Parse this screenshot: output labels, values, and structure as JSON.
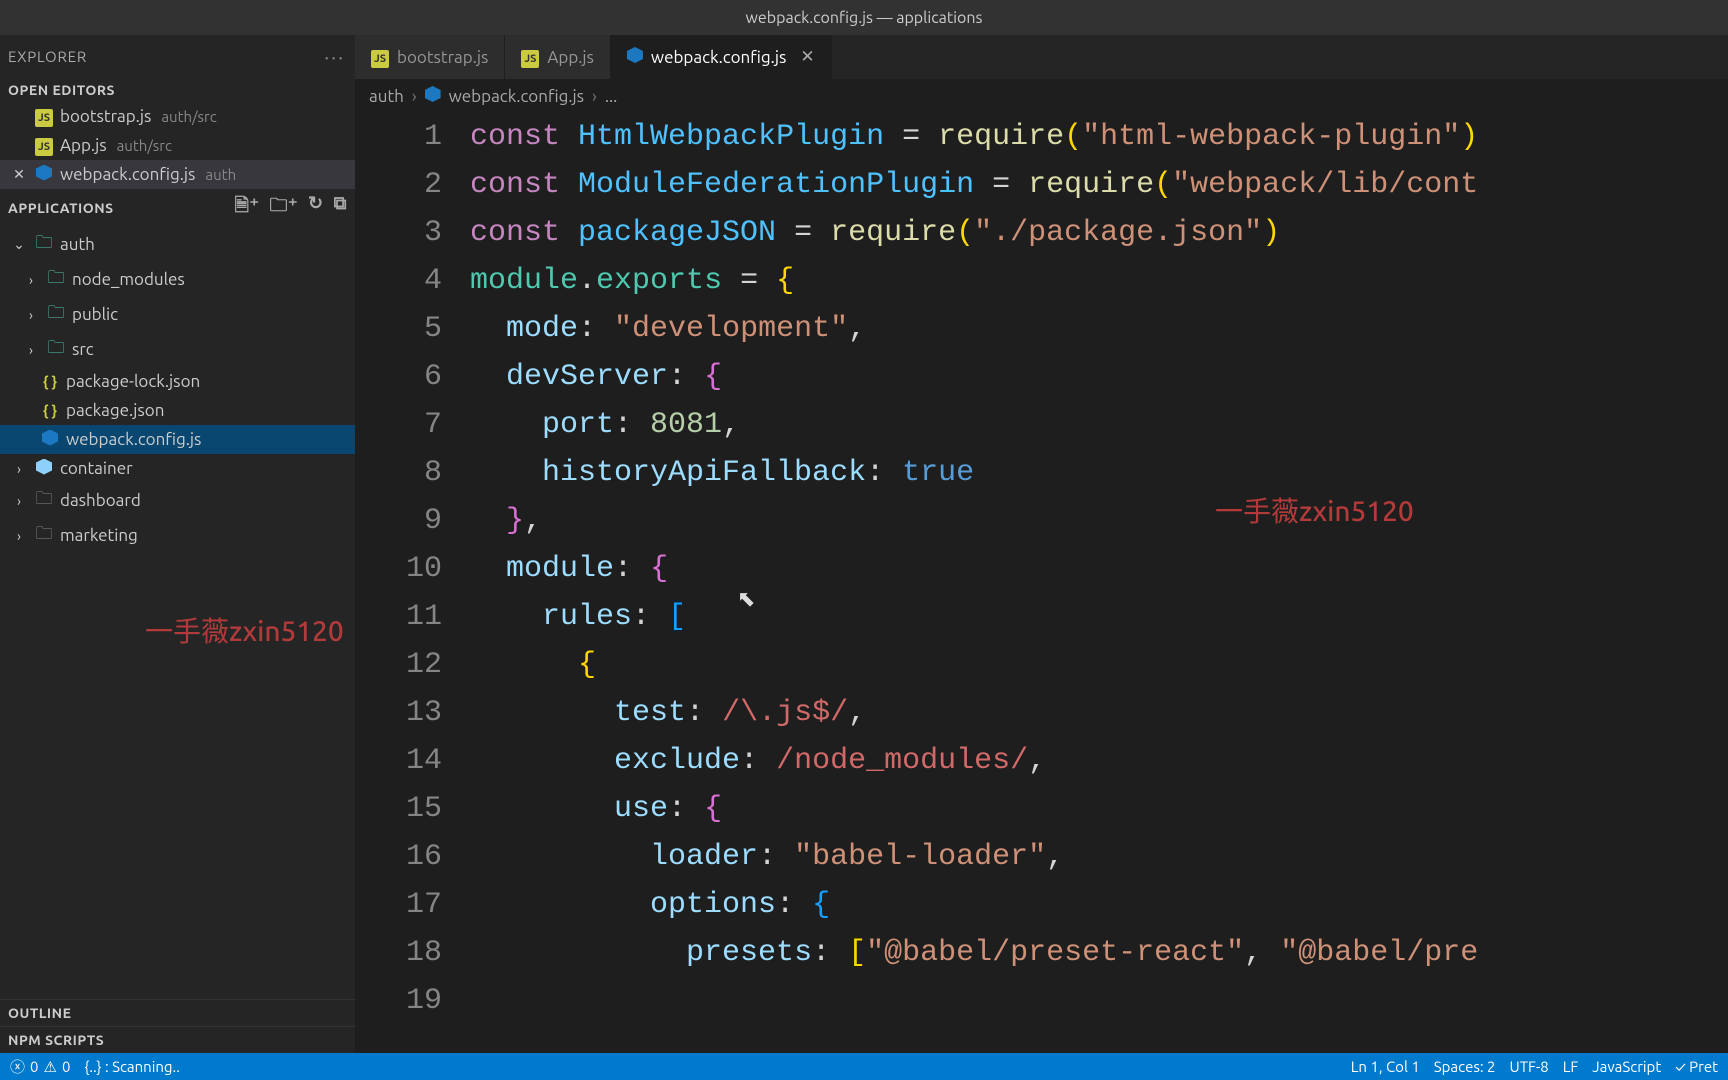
{
  "window": {
    "title": "webpack.config.js — applications"
  },
  "explorer": {
    "header": "EXPLORER",
    "open_editors_label": "OPEN EDITORS",
    "applications_label": "APPLICATIONS",
    "outline_label": "OUTLINE",
    "npm_label": "NPM SCRIPTS",
    "open_editors": [
      {
        "icon": "js",
        "name": "bootstrap.js",
        "meta": "auth/src"
      },
      {
        "icon": "js",
        "name": "App.js",
        "meta": "auth/src"
      },
      {
        "icon": "webpack",
        "name": "webpack.config.js",
        "meta": "auth",
        "active": true
      }
    ],
    "tree": {
      "root": "auth",
      "children": [
        {
          "type": "folder-green",
          "name": "node_modules"
        },
        {
          "type": "folder-green",
          "name": "public"
        },
        {
          "type": "folder-green",
          "name": "src"
        },
        {
          "type": "json",
          "name": "package-lock.json"
        },
        {
          "type": "json",
          "name": "package.json"
        },
        {
          "type": "webpack",
          "name": "webpack.config.js",
          "selected": true
        }
      ],
      "siblings": [
        {
          "type": "webpack-out",
          "name": "container"
        },
        {
          "type": "folder-grey",
          "name": "dashboard"
        },
        {
          "type": "folder-grey",
          "name": "marketing"
        }
      ]
    }
  },
  "tabs": [
    {
      "icon": "js",
      "label": "bootstrap.js"
    },
    {
      "icon": "js",
      "label": "App.js"
    },
    {
      "icon": "webpack",
      "label": "webpack.config.js",
      "active": true
    }
  ],
  "breadcrumb": {
    "segments": [
      "auth",
      "webpack.config.js",
      "..."
    ],
    "icon": "webpack"
  },
  "code": {
    "lines": [
      [
        {
          "c": "tk-kw",
          "t": "const "
        },
        {
          "c": "tk-var",
          "t": "HtmlWebpackPlugin"
        },
        {
          "c": "tk-punc",
          "t": " = "
        },
        {
          "c": "tk-fn",
          "t": "require"
        },
        {
          "c": "tk-brace-y",
          "t": "("
        },
        {
          "c": "tk-str",
          "t": "\"html-webpack-plugin\""
        },
        {
          "c": "tk-brace-y",
          "t": ")"
        }
      ],
      [
        {
          "c": "tk-kw",
          "t": "const "
        },
        {
          "c": "tk-var",
          "t": "ModuleFederationPlugin"
        },
        {
          "c": "tk-punc",
          "t": " = "
        },
        {
          "c": "tk-fn",
          "t": "require"
        },
        {
          "c": "tk-brace-y",
          "t": "("
        },
        {
          "c": "tk-str",
          "t": "\"webpack/lib/cont"
        }
      ],
      [
        {
          "c": "tk-kw",
          "t": "const "
        },
        {
          "c": "tk-var",
          "t": "packageJSON"
        },
        {
          "c": "tk-punc",
          "t": " = "
        },
        {
          "c": "tk-fn",
          "t": "require"
        },
        {
          "c": "tk-brace-y",
          "t": "("
        },
        {
          "c": "tk-str",
          "t": "\"./package.json\""
        },
        {
          "c": "tk-brace-y",
          "t": ")"
        }
      ],
      [
        {
          "c": "",
          "t": ""
        }
      ],
      [
        {
          "c": "tk-mod",
          "t": "module"
        },
        {
          "c": "tk-punc",
          "t": "."
        },
        {
          "c": "tk-mod",
          "t": "exports"
        },
        {
          "c": "tk-punc",
          "t": " = "
        },
        {
          "c": "tk-brace-y",
          "t": "{"
        }
      ],
      [
        {
          "c": "",
          "t": "  "
        },
        {
          "c": "tk-prop",
          "t": "mode"
        },
        {
          "c": "tk-punc",
          "t": ": "
        },
        {
          "c": "tk-str",
          "t": "\"development\""
        },
        {
          "c": "tk-punc",
          "t": ","
        }
      ],
      [
        {
          "c": "",
          "t": "  "
        },
        {
          "c": "tk-prop",
          "t": "devServer"
        },
        {
          "c": "tk-punc",
          "t": ": "
        },
        {
          "c": "tk-brace-p",
          "t": "{"
        }
      ],
      [
        {
          "c": "",
          "t": "    "
        },
        {
          "c": "tk-prop",
          "t": "port"
        },
        {
          "c": "tk-punc",
          "t": ": "
        },
        {
          "c": "tk-num",
          "t": "8081"
        },
        {
          "c": "tk-punc",
          "t": ","
        }
      ],
      [
        {
          "c": "",
          "t": "    "
        },
        {
          "c": "tk-prop",
          "t": "historyApiFallback"
        },
        {
          "c": "tk-punc",
          "t": ": "
        },
        {
          "c": "tk-bool",
          "t": "true"
        }
      ],
      [
        {
          "c": "",
          "t": "  "
        },
        {
          "c": "tk-brace-p",
          "t": "}"
        },
        {
          "c": "tk-punc",
          "t": ","
        }
      ],
      [
        {
          "c": "",
          "t": "  "
        },
        {
          "c": "tk-prop",
          "t": "module"
        },
        {
          "c": "tk-punc",
          "t": ": "
        },
        {
          "c": "tk-brace-p",
          "t": "{"
        }
      ],
      [
        {
          "c": "",
          "t": "    "
        },
        {
          "c": "tk-prop",
          "t": "rules"
        },
        {
          "c": "tk-punc",
          "t": ": "
        },
        {
          "c": "tk-brace-b",
          "t": "["
        }
      ],
      [
        {
          "c": "",
          "t": "      "
        },
        {
          "c": "tk-brace-y",
          "t": "{"
        }
      ],
      [
        {
          "c": "",
          "t": "        "
        },
        {
          "c": "tk-prop",
          "t": "test"
        },
        {
          "c": "tk-punc",
          "t": ": "
        },
        {
          "c": "tk-regex",
          "t": "/\\.js$/"
        },
        {
          "c": "tk-punc",
          "t": ","
        }
      ],
      [
        {
          "c": "",
          "t": "        "
        },
        {
          "c": "tk-prop",
          "t": "exclude"
        },
        {
          "c": "tk-punc",
          "t": ": "
        },
        {
          "c": "tk-regex",
          "t": "/node_modules/"
        },
        {
          "c": "tk-punc",
          "t": ","
        }
      ],
      [
        {
          "c": "",
          "t": "        "
        },
        {
          "c": "tk-prop",
          "t": "use"
        },
        {
          "c": "tk-punc",
          "t": ": "
        },
        {
          "c": "tk-brace-p",
          "t": "{"
        }
      ],
      [
        {
          "c": "",
          "t": "          "
        },
        {
          "c": "tk-prop",
          "t": "loader"
        },
        {
          "c": "tk-punc",
          "t": ": "
        },
        {
          "c": "tk-str",
          "t": "\"babel-loader\""
        },
        {
          "c": "tk-punc",
          "t": ","
        }
      ],
      [
        {
          "c": "",
          "t": "          "
        },
        {
          "c": "tk-prop",
          "t": "options"
        },
        {
          "c": "tk-punc",
          "t": ": "
        },
        {
          "c": "tk-brace-b",
          "t": "{"
        }
      ],
      [
        {
          "c": "",
          "t": "            "
        },
        {
          "c": "tk-prop",
          "t": "presets"
        },
        {
          "c": "tk-punc",
          "t": ": "
        },
        {
          "c": "tk-brace-y",
          "t": "["
        },
        {
          "c": "tk-str",
          "t": "\"@babel/preset-react\""
        },
        {
          "c": "tk-punc",
          "t": ", "
        },
        {
          "c": "tk-str",
          "t": "\"@babel/pre"
        }
      ]
    ]
  },
  "statusbar": {
    "errors": "0",
    "warnings": "0",
    "scanning": "{..} : Scanning..",
    "ln_col": "Ln 1, Col 1",
    "spaces": "Spaces: 2",
    "encoding": "UTF-8",
    "eol": "LF",
    "language": "JavaScript",
    "prettier": "✓ Pret"
  },
  "watermark": "一手薇zxin5120"
}
